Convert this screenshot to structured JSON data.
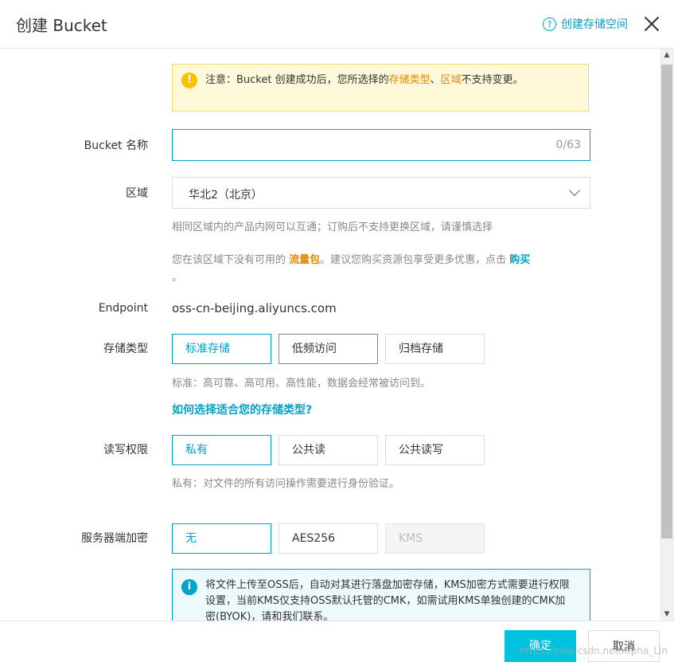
{
  "header": {
    "title": "创建 Bucket",
    "help_link": "创建存储空间"
  },
  "warning": {
    "prefix": "注意：Bucket 创建成功后，您所选择的",
    "term1": "存储类型",
    "sep": "、",
    "term2": "区域",
    "suffix": "不支持变更。"
  },
  "bucket_name": {
    "label": "Bucket 名称",
    "value": "",
    "counter": "0/63"
  },
  "region": {
    "label": "区域",
    "selected": "华北2（北京）",
    "hint": "相同区域内的产品内网可以互通；订购后不支持更换区域，请谨慎选择",
    "notice_prefix": "您在该区域下没有可用的 ",
    "notice_pkg": "流量包",
    "notice_mid": "。建议您购买资源包享受更多优惠，点击 ",
    "notice_buy": "购买",
    "notice_end": "。"
  },
  "endpoint": {
    "label": "Endpoint",
    "value": "oss-cn-beijing.aliyuncs.com"
  },
  "storage_class": {
    "label": "存储类型",
    "options": [
      "标准存储",
      "低频访问",
      "归档存储"
    ],
    "hint": "标准：高可靠、高可用、高性能，数据会经常被访问到。",
    "help_link": "如何选择适合您的存储类型?"
  },
  "acl": {
    "label": "读写权限",
    "options": [
      "私有",
      "公共读",
      "公共读写"
    ],
    "hint": "私有：对文件的所有访问操作需要进行身份验证。"
  },
  "encryption": {
    "label": "服务器端加密",
    "options": [
      "无",
      "AES256",
      "KMS"
    ],
    "info": "将文件上传至OSS后，自动对其进行落盘加密存储，KMS加密方式需要进行权限设置，当前KMS仅支持OSS默认托管的CMK，如需试用KMS单独创建的CMK加密(BYOK)，请和我们联系。"
  },
  "footer": {
    "ok": "确定",
    "cancel": "取消",
    "watermark": "https://blog.csdn.net/Alpha_Lin"
  },
  "colors": {
    "accent": "#00a2ca",
    "primary_button": "#00c1de",
    "warning_bg": "#fff8d9",
    "highlight": "#e68a00"
  }
}
